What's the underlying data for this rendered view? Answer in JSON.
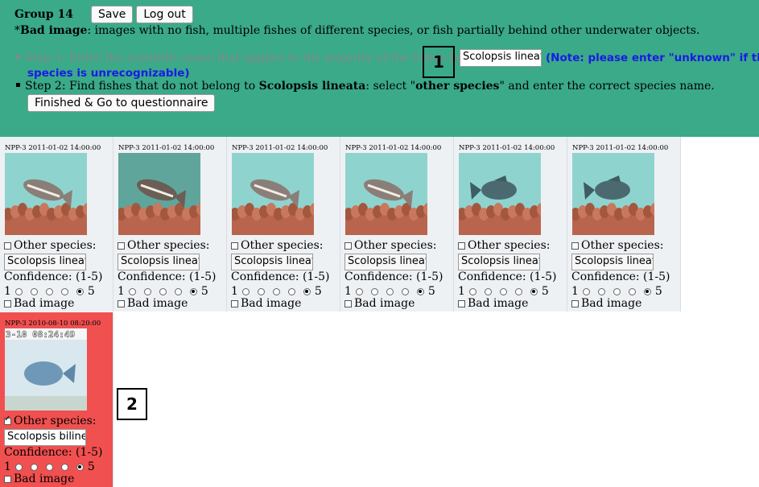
{
  "header": {
    "group_label": "Group 14",
    "save_label": "Save",
    "logout_label": "Log out",
    "note_prefix": "*",
    "note_bold": "Bad image",
    "note_rest": ": images with no fish, multiple fishes of different species, or fish partially behind other underwater objects.",
    "step1_text": "Step 1: Enter the scientific name that applies to the majority of the fishes below:",
    "scientific_name_value": "Scolopsis lineata",
    "step1_note_line1": "(Note: please enter \"unknown\" if the",
    "step1_note_line2": "species is unrecognizable)",
    "step2_a": "Step 2: Find fishes that do not belong to ",
    "step2_species": "Scolopsis lineata",
    "step2_b": ": select \"",
    "step2_other": "other species",
    "step2_c": "\" and enter the correct species name.",
    "finish_label": "Finished & Go to questionnaire"
  },
  "markers": {
    "m1": "1",
    "m2": "2"
  },
  "labels": {
    "other_species": "Other species:",
    "confidence": "Confidence: (1-5)",
    "scale_min": "1",
    "scale_max": "5",
    "bad_image": "Bad image"
  },
  "cards": [
    {
      "caption": "NPP-3  2011-01-02 14:00:00",
      "species": "Scolopsis lineata",
      "other_checked": false,
      "confidence": 5,
      "bad_image": false,
      "flagged": false
    },
    {
      "caption": "NPP-3  2011-01-02 14:00:00",
      "species": "Scolopsis lineata",
      "other_checked": false,
      "confidence": 5,
      "bad_image": false,
      "flagged": false
    },
    {
      "caption": "NPP-3  2011-01-02 14:00:00",
      "species": "Scolopsis lineata",
      "other_checked": false,
      "confidence": 5,
      "bad_image": false,
      "flagged": false
    },
    {
      "caption": "NPP-3  2011-01-02 14:00:00",
      "species": "Scolopsis lineata",
      "other_checked": false,
      "confidence": 5,
      "bad_image": false,
      "flagged": false
    },
    {
      "caption": "NPP-3  2011-01-02 14:00:00",
      "species": "Scolopsis lineata",
      "other_checked": false,
      "confidence": 5,
      "bad_image": false,
      "flagged": false
    },
    {
      "caption": "NPP-3  2011-01-02 14:00:00",
      "species": "Scolopsis lineata",
      "other_checked": false,
      "confidence": 5,
      "bad_image": false,
      "flagged": false
    },
    {
      "caption": "NPP-3  2010-08-10 08:20:00",
      "image_overlay_text": "3-10 08:24:49",
      "species": "Scolopsis bilineata",
      "other_checked": true,
      "confidence": 5,
      "bad_image": false,
      "flagged": true
    }
  ],
  "colors": {
    "header_bg": "#3aaa88",
    "card_bg": "#eef1f4",
    "flagged_bg": "#f0504f",
    "note_blue": "#1a1ae6"
  }
}
